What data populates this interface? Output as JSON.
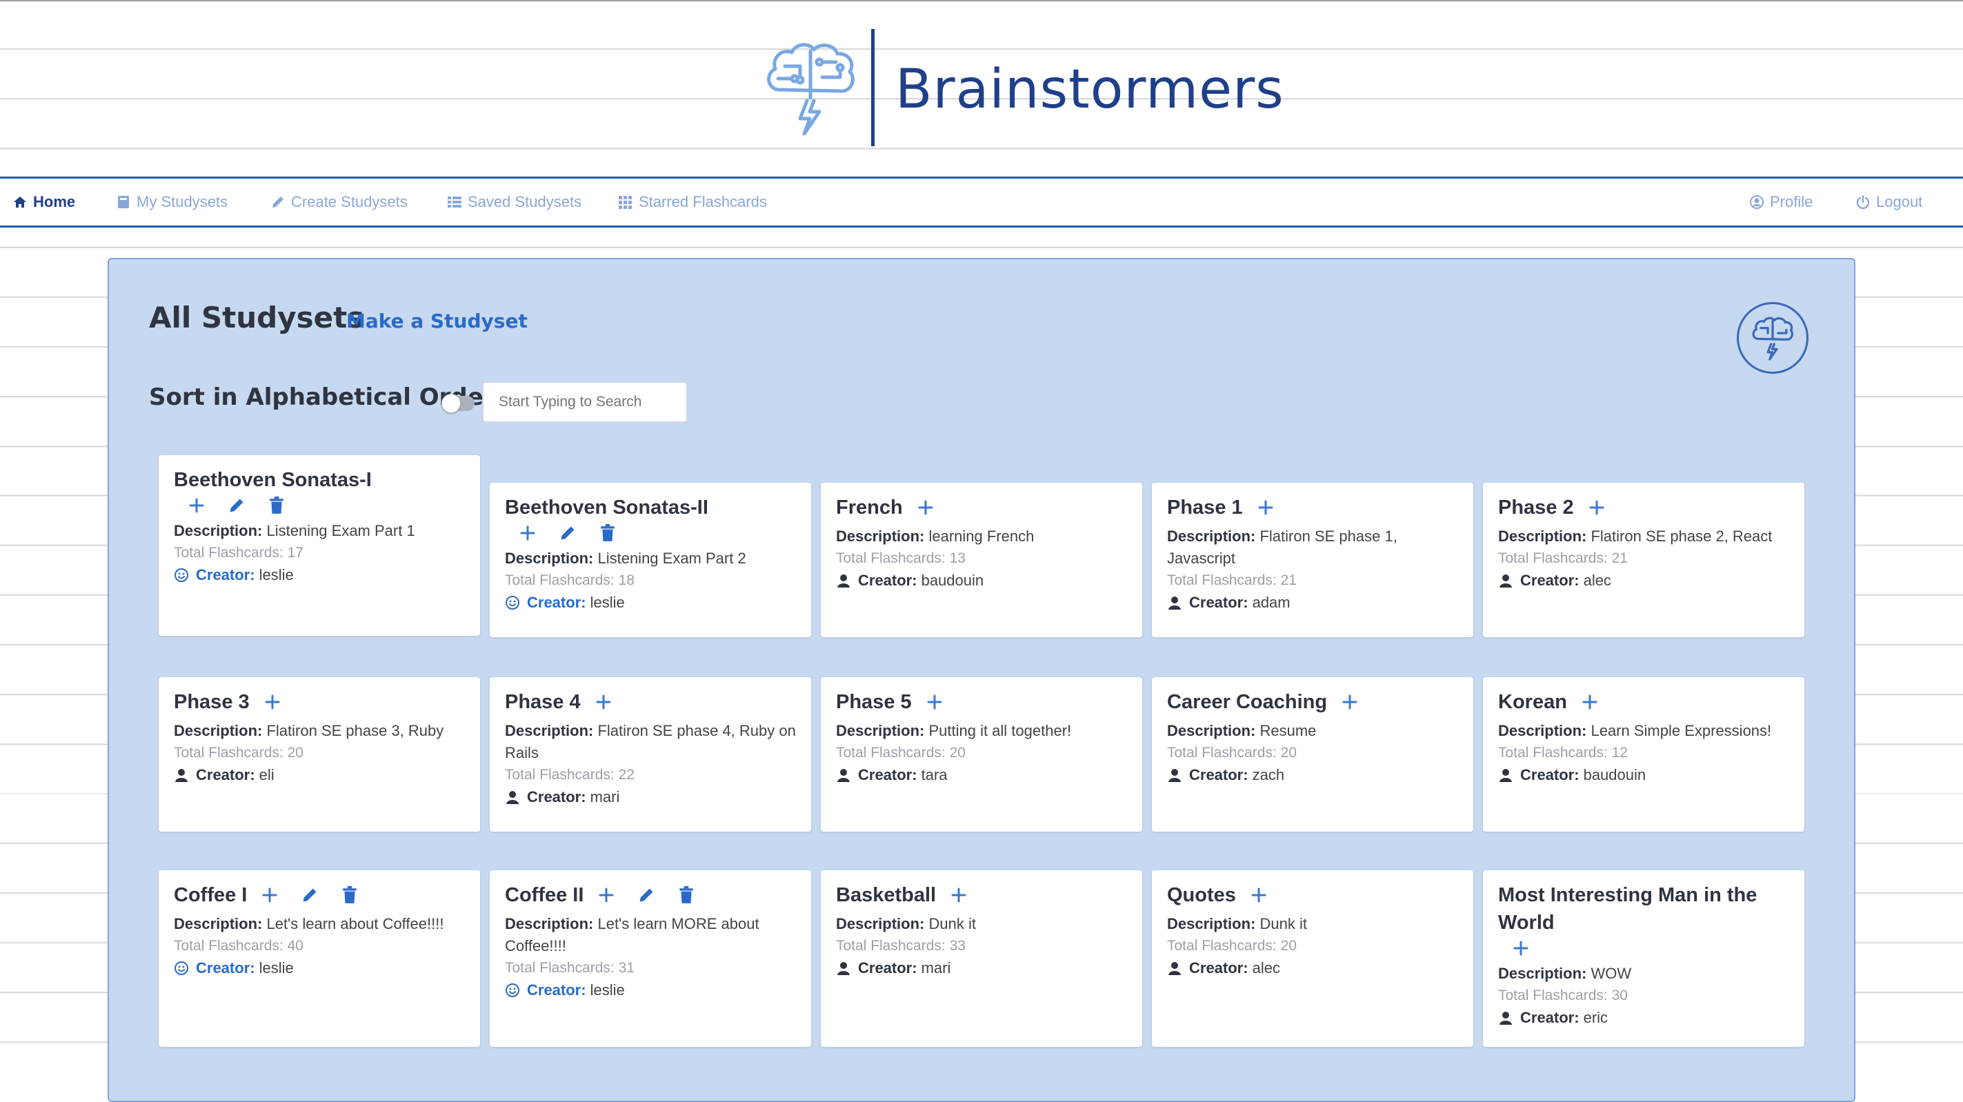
{
  "app": {
    "title": "Brainstormers"
  },
  "nav": {
    "home": "Home",
    "my_studysets": "My Studysets",
    "create_studysets": "Create Studysets",
    "saved_studysets": "Saved Studysets",
    "starred_flashcards": "Starred Flashcards",
    "profile": "Profile",
    "logout": "Logout"
  },
  "page": {
    "title": "All Studysets",
    "make_link": "Make a Studyset",
    "sort_label": "Sort in Alphabetical Order",
    "search_placeholder": "Start Typing to Search"
  },
  "labels": {
    "description": "Description:",
    "creator": "Creator:",
    "total_prefix": "Total Flashcards: "
  },
  "colors": {
    "primary": "#1f3f8a",
    "accent": "#2a6ac8",
    "panel_bg": "#c6d9f0",
    "nav_inactive": "#8aa6d8"
  },
  "studysets": [
    {
      "title": "Beethoven Sonatas-I",
      "description": "Listening Exam Part 1",
      "total": "Total Flashcards: 17",
      "creator": "leslie",
      "owned": true
    },
    {
      "title": "Beethoven Sonatas-II",
      "description": "Listening Exam Part 2",
      "total": "Total Flashcards: 18",
      "creator": "leslie",
      "owned": true
    },
    {
      "title": "French",
      "description": "learning French",
      "total": "Total Flashcards: 13",
      "creator": "baudouin",
      "owned": false
    },
    {
      "title": "Phase 1",
      "description": "Flatiron SE phase 1, Javascript",
      "total": "Total Flashcards: 21",
      "creator": "adam",
      "owned": false
    },
    {
      "title": "Phase 2",
      "description": "Flatiron SE phase 2, React",
      "total": "Total Flashcards: 21",
      "creator": "alec",
      "owned": false
    },
    {
      "title": "Phase 3",
      "description": "Flatiron SE phase 3, Ruby",
      "total": "Total Flashcards: 20",
      "creator": "eli",
      "owned": false
    },
    {
      "title": "Phase 4",
      "description": "Flatiron SE phase 4, Ruby on Rails",
      "total": "Total Flashcards: 22",
      "creator": "mari",
      "owned": false
    },
    {
      "title": "Phase 5",
      "description": "Putting it all together!",
      "total": "Total Flashcards: 20",
      "creator": "tara",
      "owned": false
    },
    {
      "title": "Career Coaching",
      "description": "Resume",
      "total": "Total Flashcards: 20",
      "creator": "zach",
      "owned": false
    },
    {
      "title": "Korean",
      "description": "Learn Simple Expressions!",
      "total": "Total Flashcards: 12",
      "creator": "baudouin",
      "owned": false
    },
    {
      "title": "Coffee I",
      "description": "Let's learn about Coffee!!!!",
      "total": "Total Flashcards: 40",
      "creator": "leslie",
      "owned": true
    },
    {
      "title": "Coffee II",
      "description": "Let's learn MORE about Coffee!!!!",
      "total": "Total Flashcards: 31",
      "creator": "leslie",
      "owned": true
    },
    {
      "title": "Basketball",
      "description": "Dunk it",
      "total": "Total Flashcards: 33",
      "creator": "mari",
      "owned": false
    },
    {
      "title": "Quotes",
      "description": "Dunk it",
      "total": "Total Flashcards: 20",
      "creator": "alec",
      "owned": false
    },
    {
      "title": "Most Interesting Man in the World",
      "description": "WOW",
      "total": "Total Flashcards: 30",
      "creator": "eric",
      "owned": false
    }
  ]
}
